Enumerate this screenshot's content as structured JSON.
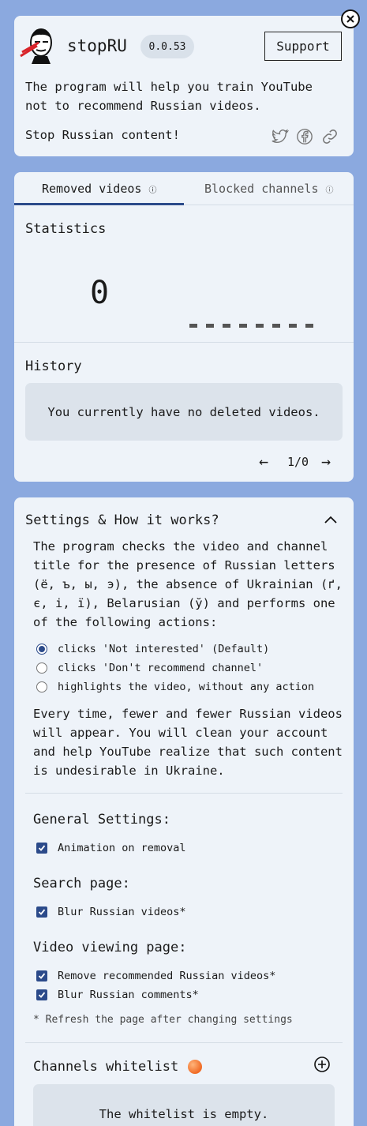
{
  "header": {
    "app_name": "stopRU",
    "version": "0.0.53",
    "support_label": "Support",
    "description": "The program will help you train YouTube not to recommend Russian videos.",
    "tagline": "Stop Russian content!",
    "social_icons": [
      "twitter-icon",
      "facebook-icon",
      "link-icon"
    ],
    "close_icon": "close-icon"
  },
  "stats_card": {
    "tabs": [
      {
        "label": "Removed videos",
        "active": true
      },
      {
        "label": "Blocked channels",
        "active": false
      }
    ],
    "info_glyph": "ⓘ",
    "statistics_title": "Statistics",
    "removed_count": "0",
    "history_title": "History",
    "history_empty": "You currently have no deleted videos.",
    "pager": {
      "prev": "←",
      "page": "1/0",
      "next": "→"
    }
  },
  "settings": {
    "title": "Settings & How it works?",
    "intro": "The program checks the video and channel title for the presence of Russian letters (ё, ъ, ы, э), the absence of Ukrainian (ґ, є, і, ї), Belarusian (ў) and performs one of the following actions:",
    "actions": [
      {
        "label": "clicks 'Not interested' (Default)",
        "selected": true
      },
      {
        "label": "clicks 'Don't recommend channel'",
        "selected": false
      },
      {
        "label": "highlights the video, without any action",
        "selected": false
      }
    ],
    "outro": "Every time, fewer and fewer Russian videos will appear. You will clean your account and help YouTube realize that such content is undesirable in Ukraine.",
    "general_title": "General Settings:",
    "general_options": [
      {
        "label": "Animation on removal",
        "checked": true
      }
    ],
    "search_title": "Search page:",
    "search_options": [
      {
        "label": "Blur Russian videos*",
        "checked": true
      }
    ],
    "video_title": "Video viewing page:",
    "video_options": [
      {
        "label": "Remove recommended Russian videos*",
        "checked": true
      },
      {
        "label": "Blur Russian comments*",
        "checked": true
      }
    ],
    "refresh_note": "* Refresh the page after changing settings",
    "whitelist_title": "Channels whitelist",
    "whitelist_empty": "The whitelist is empty."
  },
  "colors": {
    "page_background": "#8ba9df",
    "card_background": "#eef3f9",
    "accent": "#2b4a8a",
    "empty_box": "#dce3eb"
  }
}
